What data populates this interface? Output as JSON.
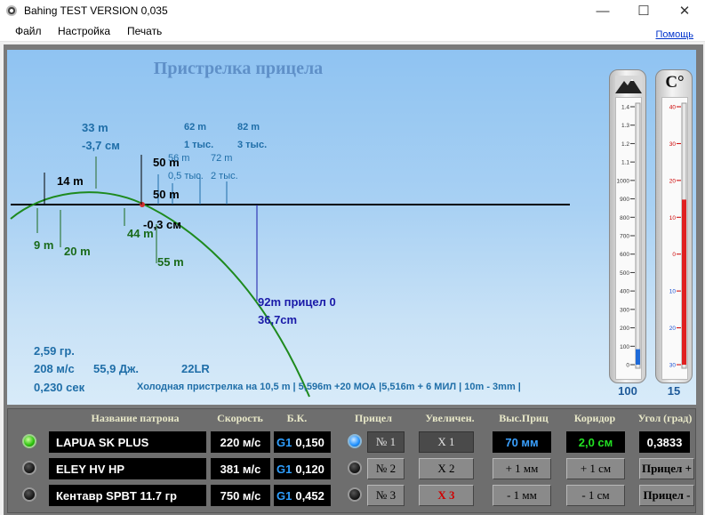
{
  "window": {
    "title": "Bahing TEST VERSION 0,035",
    "min": "—",
    "max": "☐",
    "close": "✕"
  },
  "menu": {
    "file": "Файл",
    "settings": "Настройка",
    "print": "Печать",
    "help": "Помощь"
  },
  "panel": {
    "title": "Пристрелка прицела",
    "labels": {
      "l33m": "33 m",
      "l37cm": "-3,7 см",
      "l14m": "14 m",
      "l50m_a": "50 m",
      "l50m_b": "50 m",
      "l62m": "62 m",
      "l1t": "1 тыс.",
      "l82m": "82 m",
      "l3t": "3 тыс.",
      "l56m": "56 m",
      "l05t": "0,5 тыс.",
      "l72m": "72 m",
      "l2t": "2 тыс.",
      "l9m": "9 m",
      "l20m": "20 m",
      "l44m": "44 m",
      "l03cm": "-0,3 см",
      "l55m": "55 m",
      "l92m": "92m  прицел 0",
      "l367cm": "36,7cm"
    },
    "info": {
      "mass": "2,59 гр.",
      "speed": "208 м/с",
      "energy": "55,9 Дж.",
      "caliber": "22LR",
      "time": "0,230 сек"
    },
    "footer": "Холодная пристрелка на 10,5 m | 5,596m +20 МОА |5,516m + 6 МИЛ | 10m  - 3mm |"
  },
  "gauges": {
    "pressure": {
      "ticks": [
        "1.4",
        "1.3",
        "1.2",
        "1.1",
        "1000",
        "900",
        "800",
        "700",
        "600",
        "500",
        "400",
        "300",
        "200",
        "100",
        "0"
      ],
      "value": "100",
      "fill_fraction": 0.06,
      "icon": "mountain-icon"
    },
    "temperature": {
      "symbol": "C°",
      "ticks": [
        "40",
        "30",
        "20",
        "10",
        "0",
        "10",
        "20",
        "30"
      ],
      "value": "15",
      "fill_fraction": 0.64
    }
  },
  "table": {
    "headers": {
      "name": "Название патрона",
      "speed": "Скорость",
      "bc": "Б.К.",
      "scope": "Прицел",
      "zoom": "Увеличен.",
      "height": "Выс.Приц",
      "corridor": "Коридор",
      "angle": "Угол (град)"
    },
    "g1": "G1",
    "rows": [
      {
        "name": "LAPUA SK PLUS",
        "speed": "220 м/с",
        "bc": "0,150",
        "scope": "№ 1",
        "zoom": "Х 1",
        "height": "70 мм",
        "corridor": "2,0 см",
        "angle": "0,3833",
        "active": true
      },
      {
        "name": "ELEY HV HP",
        "speed": "381 м/с",
        "bc": "0,120",
        "scope": "№ 2",
        "zoom": "Х 2",
        "height": "+ 1 мм",
        "corridor": "+ 1 см",
        "angle": "Прицел +",
        "active": false
      },
      {
        "name": "Кентавр SPBT 11.7 гр",
        "speed": "750 м/с",
        "bc": "0,452",
        "scope": "№ 3",
        "zoom": "Х 3",
        "height": "- 1 мм",
        "corridor": "- 1 см",
        "angle": "Прицел -",
        "active": false
      }
    ]
  },
  "colors": {
    "trajectory": "#1e8a1e",
    "horizon": "#000000",
    "label_blue": "#1f6ea8",
    "label_green": "#1a6a1a",
    "label_navy": "#1a1aa8"
  }
}
